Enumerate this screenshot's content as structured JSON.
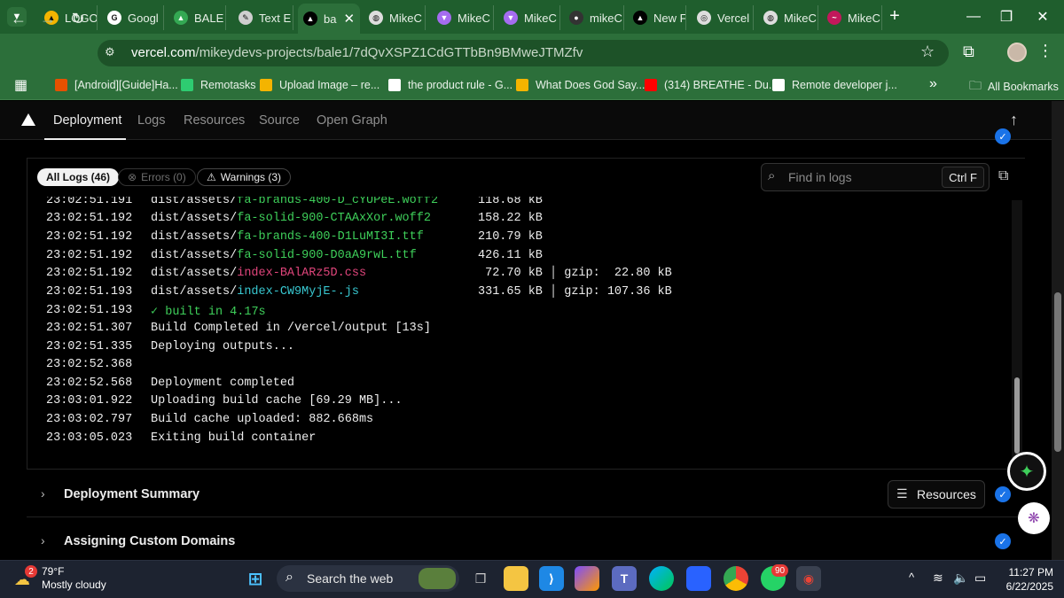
{
  "browser": {
    "tabs": [
      {
        "label": "LOGO",
        "color": "#f4b400",
        "glyph": "▲"
      },
      {
        "label": "Googl",
        "color": "#ffffff",
        "glyph": "G"
      },
      {
        "label": "BALE",
        "color": "#34a853",
        "glyph": "▲"
      },
      {
        "label": "Text E",
        "color": "#cfcfcf",
        "glyph": "✎"
      },
      {
        "label": "ba",
        "color": "#000000",
        "glyph": "▲"
      },
      {
        "label": "MikeC",
        "color": "#dddddd",
        "glyph": "◍"
      },
      {
        "label": "MikeC",
        "color": "#a56cf0",
        "glyph": "▼"
      },
      {
        "label": "MikeC",
        "color": "#a56cf0",
        "glyph": "▼"
      },
      {
        "label": "mikeC",
        "color": "#333333",
        "glyph": "●"
      },
      {
        "label": "New F",
        "color": "#000000",
        "glyph": "▲"
      },
      {
        "label": "Vercel",
        "color": "#dddddd",
        "glyph": "◎"
      },
      {
        "label": "MikeC",
        "color": "#dddddd",
        "glyph": "◍"
      },
      {
        "label": "MikeC",
        "color": "#c2185b",
        "glyph": "~"
      }
    ],
    "active_tab_close": "✕",
    "new_tab": "+",
    "url_host": "vercel.com",
    "url_path": "/mikeydevs-projects/bale1/7dQvXSPZ1CdGTTbBn9BMweJTMZfv",
    "bookmarks": [
      {
        "label": "[Android][Guide]Ha...",
        "color": "#e65100"
      },
      {
        "label": "Remotasks",
        "color": "#2ecc71"
      },
      {
        "label": "Upload Image – re...",
        "color": "#f4b400"
      },
      {
        "label": "the product rule - G...",
        "color": "#ffffff"
      },
      {
        "label": "What Does God Say...",
        "color": "#f4b400"
      },
      {
        "label": "(314) BREATHE - Du...",
        "color": "#ff0000"
      },
      {
        "label": "Remote developer j...",
        "color": "#ffffff"
      }
    ],
    "more_bookmarks": "»",
    "all_bookmarks": "All Bookmarks"
  },
  "vercel": {
    "nav": [
      "Deployment",
      "Logs",
      "Resources",
      "Source",
      "Open Graph"
    ],
    "filters": {
      "all": "All Logs (46)",
      "errors": "Errors (0)",
      "warnings": "Warnings (3)"
    },
    "find_placeholder": "Find in logs",
    "find_shortcut": "Ctrl F",
    "logs": [
      {
        "ts": "23:02:51.191",
        "prefix": "dist/assets/",
        "file": "fa-brands-400-D_cYUPeE.woff2",
        "fileColor": "green",
        "rest": "",
        "size": "118.68 kB"
      },
      {
        "ts": "23:02:51.192",
        "prefix": "dist/assets/",
        "file": "fa-solid-900-CTAAxXor.woff2",
        "fileColor": "green",
        "rest": "",
        "size": "158.22 kB"
      },
      {
        "ts": "23:02:51.192",
        "prefix": "dist/assets/",
        "file": "fa-brands-400-D1LuMI3I.ttf",
        "fileColor": "green",
        "rest": "",
        "size": "210.79 kB"
      },
      {
        "ts": "23:02:51.192",
        "prefix": "dist/assets/",
        "file": "fa-solid-900-D0aA9rwL.ttf",
        "fileColor": "green",
        "rest": "",
        "size": "426.11 kB"
      },
      {
        "ts": "23:02:51.192",
        "prefix": "dist/assets/",
        "file": "index-BAlARz5D.css",
        "fileColor": "pink",
        "rest": "",
        "size": " 72.70 kB │ gzip:  22.80 kB"
      },
      {
        "ts": "23:02:51.193",
        "prefix": "dist/assets/",
        "file": "index-CW9MyjE-.js",
        "fileColor": "cyan",
        "rest": "",
        "size": "331.65 kB │ gzip: 107.36 kB"
      },
      {
        "ts": "23:02:51.193",
        "prefix": "",
        "file": "✓ built in 4.17s",
        "fileColor": "green",
        "rest": "",
        "size": ""
      },
      {
        "ts": "23:02:51.307",
        "prefix": "Build Completed in /vercel/output [13s]",
        "file": "",
        "fileColor": "",
        "rest": "",
        "size": ""
      },
      {
        "ts": "23:02:51.335",
        "prefix": "Deploying outputs...",
        "file": "",
        "fileColor": "",
        "rest": "",
        "size": ""
      },
      {
        "ts": "23:02:52.368",
        "prefix": "",
        "file": "",
        "fileColor": "",
        "rest": "",
        "size": ""
      },
      {
        "ts": "23:02:52.568",
        "prefix": "Deployment completed",
        "file": "",
        "fileColor": "",
        "rest": "",
        "size": ""
      },
      {
        "ts": "23:03:01.922",
        "prefix": "Uploading build cache [69.29 MB]...",
        "file": "",
        "fileColor": "",
        "rest": "",
        "size": ""
      },
      {
        "ts": "23:03:02.797",
        "prefix": "Build cache uploaded: 882.668ms",
        "file": "",
        "fileColor": "",
        "rest": "",
        "size": ""
      },
      {
        "ts": "23:03:05.023",
        "prefix": "Exiting build container",
        "file": "",
        "fileColor": "",
        "rest": "",
        "size": ""
      }
    ],
    "sections": [
      {
        "title": "Deployment Summary"
      },
      {
        "title": "Assigning Custom Domains"
      }
    ],
    "resources_button": "Resources"
  },
  "taskbar": {
    "weather_temp": "79°F",
    "weather_desc": "Mostly cloudy",
    "weather_badge": "2",
    "search_placeholder": "Search the web",
    "whatsapp_badge": "90",
    "time": "11:27 PM",
    "date": "6/22/2025"
  }
}
